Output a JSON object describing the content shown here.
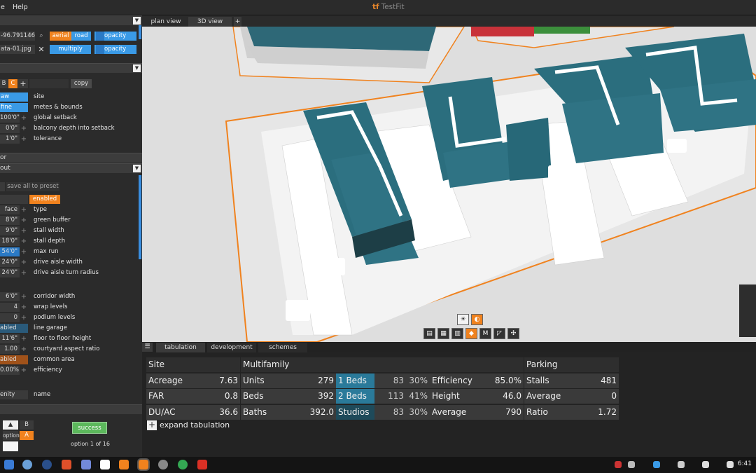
{
  "window": {
    "menu_file_fragment": "e",
    "menu_help": "Help",
    "title": "TestFit"
  },
  "left_panel": {
    "coord_value": "-96.791146",
    "aerial_label": "aerial",
    "road_label": "road",
    "opacity_label": "opacity",
    "image_value": "ata-01.jpg",
    "multiply_label": "multiply",
    "opacity2_label": "opacity",
    "site_tabs": {
      "b": "B",
      "c": "C",
      "add": "+",
      "copy": "copy"
    },
    "site_rows": [
      {
        "value": "aw",
        "label": "site"
      },
      {
        "value": "fine",
        "label": "metes & bounds"
      },
      {
        "value": "100'0\"",
        "label": "global setback"
      },
      {
        "value": "0'0\"",
        "label": "balcony depth into setback"
      },
      {
        "value": "1'0\"",
        "label": "tolerance"
      }
    ],
    "section2": "or",
    "section3": "out",
    "save_preset": "save all to preset",
    "enabled_label": "enabled",
    "parking_rows": [
      {
        "value": "face",
        "label": "type"
      },
      {
        "value": "8'0\"",
        "label": "green buffer"
      },
      {
        "value": "9'0\"",
        "label": "stall width"
      },
      {
        "value": "18'0\"",
        "label": "stall depth"
      },
      {
        "value": "54'0\"",
        "label": "max run"
      },
      {
        "value": "24'0\"",
        "label": "drive aisle width"
      },
      {
        "value": "24'0\"",
        "label": "drive aisle turn radius"
      }
    ],
    "building_rows": [
      {
        "value": "6'0\"",
        "label": "corridor width"
      },
      {
        "value": "4",
        "label": "wrap levels"
      },
      {
        "value": "0",
        "label": "podium levels"
      },
      {
        "value": "abled",
        "label": "line garage"
      },
      {
        "value": "11'6\"",
        "label": "floor to floor height"
      },
      {
        "value": "1.00",
        "label": "courtyard aspect ratio"
      },
      {
        "value": "abled",
        "label": "common area"
      },
      {
        "value": "0.00%",
        "label": "efficiency"
      }
    ],
    "amenity_value": "enity",
    "amenity_label": "name",
    "option_b": "B",
    "option_a": "A",
    "option_word": "option",
    "success": "success",
    "option_count": "option 1 of 16"
  },
  "view": {
    "tab_plan": "plan view",
    "tab_3d": "3D view",
    "tab_add": "+",
    "tools": [
      "M"
    ]
  },
  "bottom": {
    "tabs": [
      "tabulation",
      "development",
      "schemes"
    ],
    "site": {
      "header": "Site",
      "rows": [
        [
          "Acreage",
          "7.63"
        ],
        [
          "FAR",
          "0.8"
        ],
        [
          "DU/AC",
          "36.6"
        ]
      ]
    },
    "multifamily": {
      "header": "Multifamily",
      "rows": [
        [
          "Units",
          "279"
        ],
        [
          "Beds",
          "392"
        ],
        [
          "Baths",
          "392.0"
        ]
      ]
    },
    "units": [
      [
        "1 Beds",
        "83",
        "30%"
      ],
      [
        "2 Beds",
        "113",
        "41%"
      ],
      [
        "Studios",
        "83",
        "30%"
      ]
    ],
    "metrics": [
      [
        "Efficiency",
        "85.0%"
      ],
      [
        "Height",
        "46.0"
      ],
      [
        "Average",
        "790"
      ]
    ],
    "parking": {
      "header": "Parking",
      "rows": [
        [
          "Stalls",
          "481"
        ],
        [
          "Average",
          "0"
        ],
        [
          "Ratio",
          "1.72"
        ]
      ]
    },
    "expand": "expand tabulation"
  },
  "taskbar": {
    "time": "6:41"
  },
  "colors": {
    "accent_orange": "#f0821e",
    "accent_blue": "#3a9ae6",
    "building_teal": "#2b6e7e",
    "success_green": "#5cb85c"
  }
}
